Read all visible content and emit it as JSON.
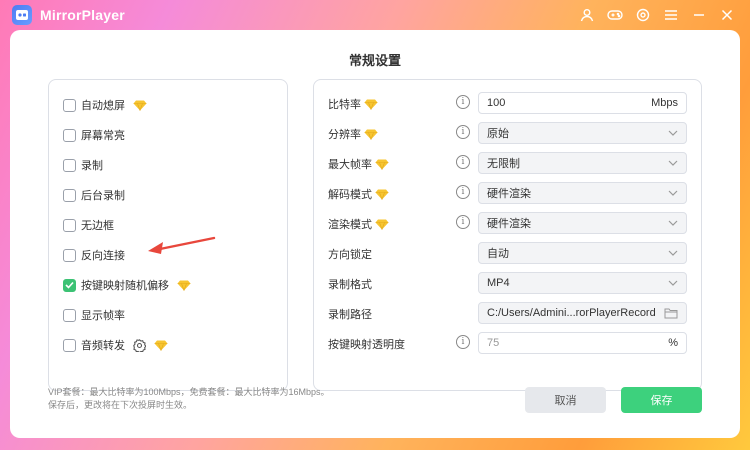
{
  "app": {
    "title": "MirrorPlayer"
  },
  "dialog": {
    "title": "常规设置"
  },
  "left_options": [
    {
      "label": "自动熄屏",
      "checked": false,
      "vip": true,
      "gear": false
    },
    {
      "label": "屏幕常亮",
      "checked": false,
      "vip": false,
      "gear": false
    },
    {
      "label": "录制",
      "checked": false,
      "vip": false,
      "gear": false
    },
    {
      "label": "后台录制",
      "checked": false,
      "vip": false,
      "gear": false
    },
    {
      "label": "无边框",
      "checked": false,
      "vip": false,
      "gear": false
    },
    {
      "label": "反向连接",
      "checked": false,
      "vip": false,
      "gear": false
    },
    {
      "label": "按键映射随机偏移",
      "checked": true,
      "vip": true,
      "gear": false
    },
    {
      "label": "显示帧率",
      "checked": false,
      "vip": false,
      "gear": false
    },
    {
      "label": "音频转发",
      "checked": false,
      "vip": true,
      "gear": true
    }
  ],
  "settings": {
    "bitrate": {
      "label": "比特率",
      "value": "100",
      "unit": "Mbps"
    },
    "resolution": {
      "label": "分辨率",
      "value": "原始"
    },
    "max_fps": {
      "label": "最大帧率",
      "value": "无限制"
    },
    "decode_mode": {
      "label": "解码模式",
      "value": "硬件渲染"
    },
    "render_mode": {
      "label": "渲染模式",
      "value": "硬件渲染"
    },
    "orientation_lock": {
      "label": "方向锁定",
      "value": "自动"
    },
    "record_format": {
      "label": "录制格式",
      "value": "MP4"
    },
    "record_path": {
      "label": "录制路径",
      "value": "C:/Users/Admini...rorPlayerRecord"
    },
    "keymap_opacity": {
      "label": "按键映射透明度",
      "value": "75",
      "unit": "%"
    }
  },
  "footnote": {
    "line1": "VIP套餐：最大比特率为100Mbps，免费套餐：最大比特率为16Mbps。",
    "line2": "保存后，更改将在下次投屏时生效。"
  },
  "buttons": {
    "cancel": "取消",
    "save": "保存"
  },
  "colors": {
    "accent_green": "#3dd17d",
    "vip_gold": "#f7c531"
  }
}
